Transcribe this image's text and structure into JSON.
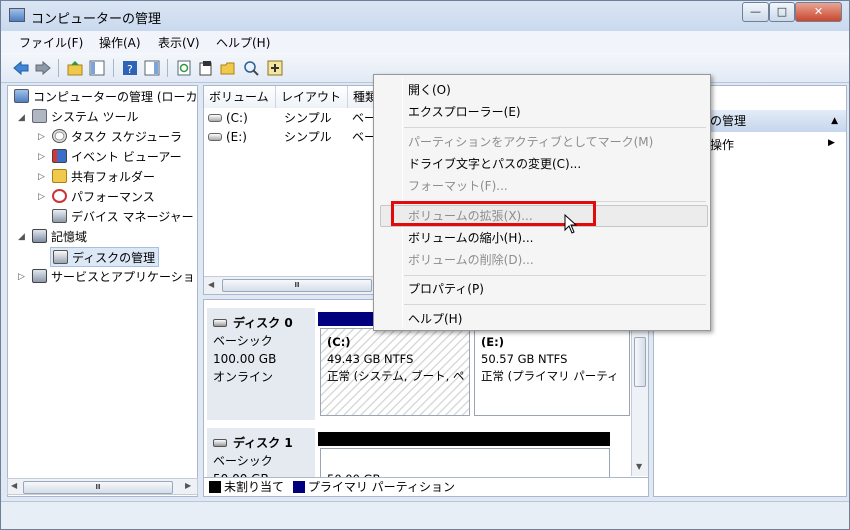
{
  "window": {
    "title": "コンピューターの管理",
    "min": "—",
    "max": "□",
    "close": "✕"
  },
  "menu": [
    "ファイル(F)",
    "操作(A)",
    "表示(V)",
    "ヘルプ(H)"
  ],
  "tree": {
    "root": "コンピューターの管理 (ローカ",
    "system_tools": "システム ツール",
    "task_scheduler": "タスク スケジューラ",
    "event_viewer": "イベント ビューアー",
    "shared_folders": "共有フォルダー",
    "performance": "パフォーマンス",
    "device_manager": "デバイス マネージャー",
    "storage": "記憶域",
    "disk_management": "ディスクの管理",
    "services": "サービスとアプリケーショ",
    "scroll_thumb": "Ⅲ"
  },
  "list": {
    "columns": [
      "ボリューム",
      "レイアウト",
      "種類"
    ],
    "rows": [
      {
        "volume": "(C:)",
        "layout": "シンプル",
        "type": "ベー"
      },
      {
        "volume": "(E:)",
        "layout": "シンプル",
        "type": "ベー"
      }
    ],
    "scroll_thumb": "Ⅲ"
  },
  "disks": [
    {
      "name": "ディスク 0",
      "kind": "ベーシック",
      "size": "100.00 GB",
      "status": "オンライン",
      "partitions": [
        {
          "label": "(C:)",
          "size": "49.43 GB NTFS",
          "status": "正常 (システム, ブート, ペ"
        },
        {
          "label": "(E:)",
          "size": "50.57 GB NTFS",
          "status": "正常 (プライマリ パーティ"
        }
      ]
    },
    {
      "name": "ディスク 1",
      "kind": "ベーシック",
      "size": "50.00 GB",
      "partitions": [
        {
          "size": "50.00 GB"
        }
      ]
    }
  ],
  "legend": {
    "unallocated": "未割り当て",
    "primary": "プライマリ パーティション"
  },
  "actions": {
    "header": "の管理",
    "item": "操作"
  },
  "context_menu": {
    "open": "開く(O)",
    "explorer": "エクスプローラー(E)",
    "mark_active": "パーティションをアクティブとしてマーク(M)",
    "change_letter": "ドライブ文字とパスの変更(C)...",
    "format": "フォーマット(F)...",
    "extend": "ボリュームの拡張(X)...",
    "shrink": "ボリュームの縮小(H)...",
    "delete": "ボリュームの削除(D)...",
    "properties": "プロパティ(P)",
    "help": "ヘルプ(H)"
  },
  "colors": {
    "primary_partition": "#00007f",
    "unallocated": "#000000",
    "highlight_box": "#e10b0b"
  }
}
